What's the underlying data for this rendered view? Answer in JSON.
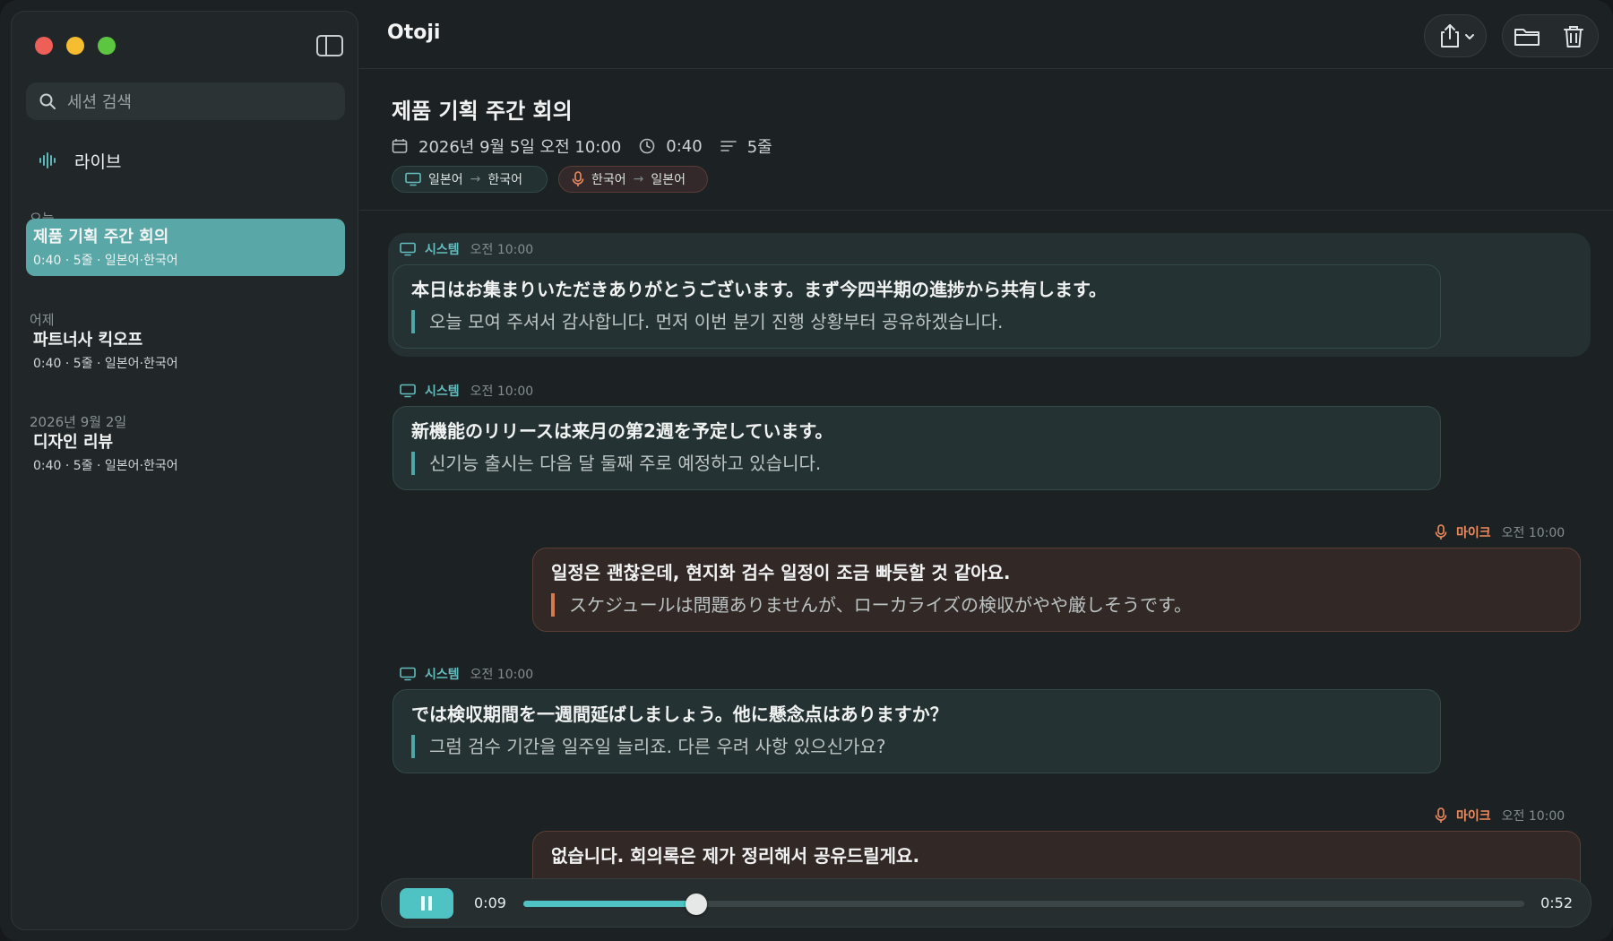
{
  "app": {
    "title": "Otoji"
  },
  "sidebar": {
    "search_placeholder": "세션 검색",
    "live_label": "라이브",
    "groups": [
      {
        "label": "오늘",
        "sessions": [
          {
            "title": "제품 기획 주간 회의",
            "meta": "0:40  ·  5줄  ·  일본어·한국어",
            "active": true
          }
        ]
      },
      {
        "label": "어제",
        "sessions": [
          {
            "title": "파트너사 킥오프",
            "meta": "0:40  ·  5줄  ·  일본어·한국어",
            "active": false
          }
        ]
      },
      {
        "label": "2026년 9월 2일",
        "sessions": [
          {
            "title": "디자인 리뷰",
            "meta": "0:40  ·  5줄  ·  일본어·한국어",
            "active": false
          }
        ]
      }
    ]
  },
  "session": {
    "title": "제품 기획 주간 회의",
    "date": "2026년 9월 5일 오전 10:00",
    "duration": "0:40",
    "lines": "5줄",
    "chips": [
      {
        "from": "일본어",
        "to": "한국어",
        "source": "system"
      },
      {
        "from": "한국어",
        "to": "일본어",
        "source": "mic"
      }
    ]
  },
  "messages": [
    {
      "source": "system",
      "speaker": "시스템",
      "time": "오전 10:00",
      "original": "本日はお集まりいただきありがとうございます。まず今四半期の進捗から共有します。",
      "translation": "오늘 모여 주셔서 감사합니다. 먼저 이번 분기 진행 상황부터 공유하겠습니다."
    },
    {
      "source": "system",
      "speaker": "시스템",
      "time": "오전 10:00",
      "original": "新機能のリリースは来月の第2週を予定しています。",
      "translation": "신기능 출시는 다음 달 둘째 주로 예정하고 있습니다."
    },
    {
      "source": "mic",
      "speaker": "마이크",
      "time": "오전 10:00",
      "original": "일정은 괜찮은데, 현지화 검수 일정이 조금 빠듯할 것 같아요.",
      "translation": "スケジュールは問題ありませんが、ローカライズの検収がやや厳しそうです。"
    },
    {
      "source": "system",
      "speaker": "시스템",
      "time": "오전 10:00",
      "original": "では検収期間を一週間延ばしましょう。他に懸念点はありますか？",
      "translation": "그럼 검수 기간을 일주일 늘리죠. 다른 우려 사항 있으신가요?"
    },
    {
      "source": "mic",
      "speaker": "마이크",
      "time": "오전 10:00",
      "original": "없습니다. 회의록은 제가 정리해서 공유드릴게요.",
      "translation": ""
    }
  ],
  "player": {
    "current": "0:09",
    "total": "0:52",
    "progress": 0.173
  },
  "colors": {
    "accent": "#4fc3c3",
    "system": "#63bcbd",
    "mic": "#ee8c5f",
    "active_session": "#5aa7a7"
  },
  "icons": [
    "search-icon",
    "waveform-icon",
    "sidebar-toggle-icon",
    "share-icon",
    "chevron-down-icon",
    "folder-icon",
    "trash-icon",
    "calendar-icon",
    "clock-icon",
    "lines-icon",
    "monitor-icon",
    "mic-icon",
    "pause-icon"
  ]
}
